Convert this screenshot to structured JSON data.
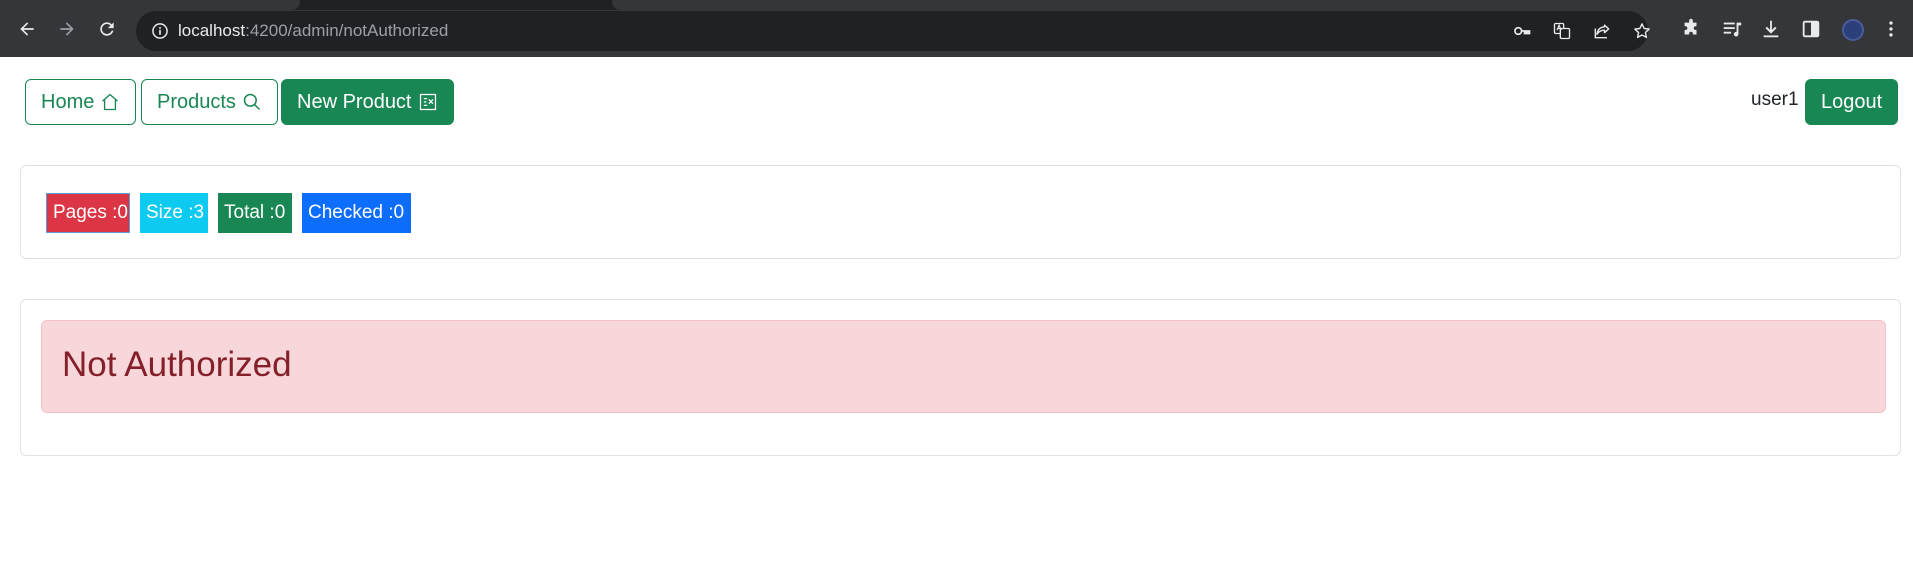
{
  "browser": {
    "url_host": "localhost",
    "url_path": ":4200/admin/notAuthorized"
  },
  "navbar": {
    "home_label": "Home",
    "products_label": "Products",
    "new_product_label": "New Product",
    "username": "user1",
    "logout_label": "Logout"
  },
  "stats": {
    "pages_label": "Pages :0",
    "size_label": "Size :3",
    "total_label": "Total :0",
    "checked_label": "Checked :0"
  },
  "colors": {
    "primary": "#198754",
    "danger": "#dc3545",
    "info": "#0dcaf0",
    "blue": "#0d6efd",
    "alert_bg": "#f8d7da",
    "alert_text": "#842029"
  },
  "alert": {
    "message": "Not Authorized"
  }
}
